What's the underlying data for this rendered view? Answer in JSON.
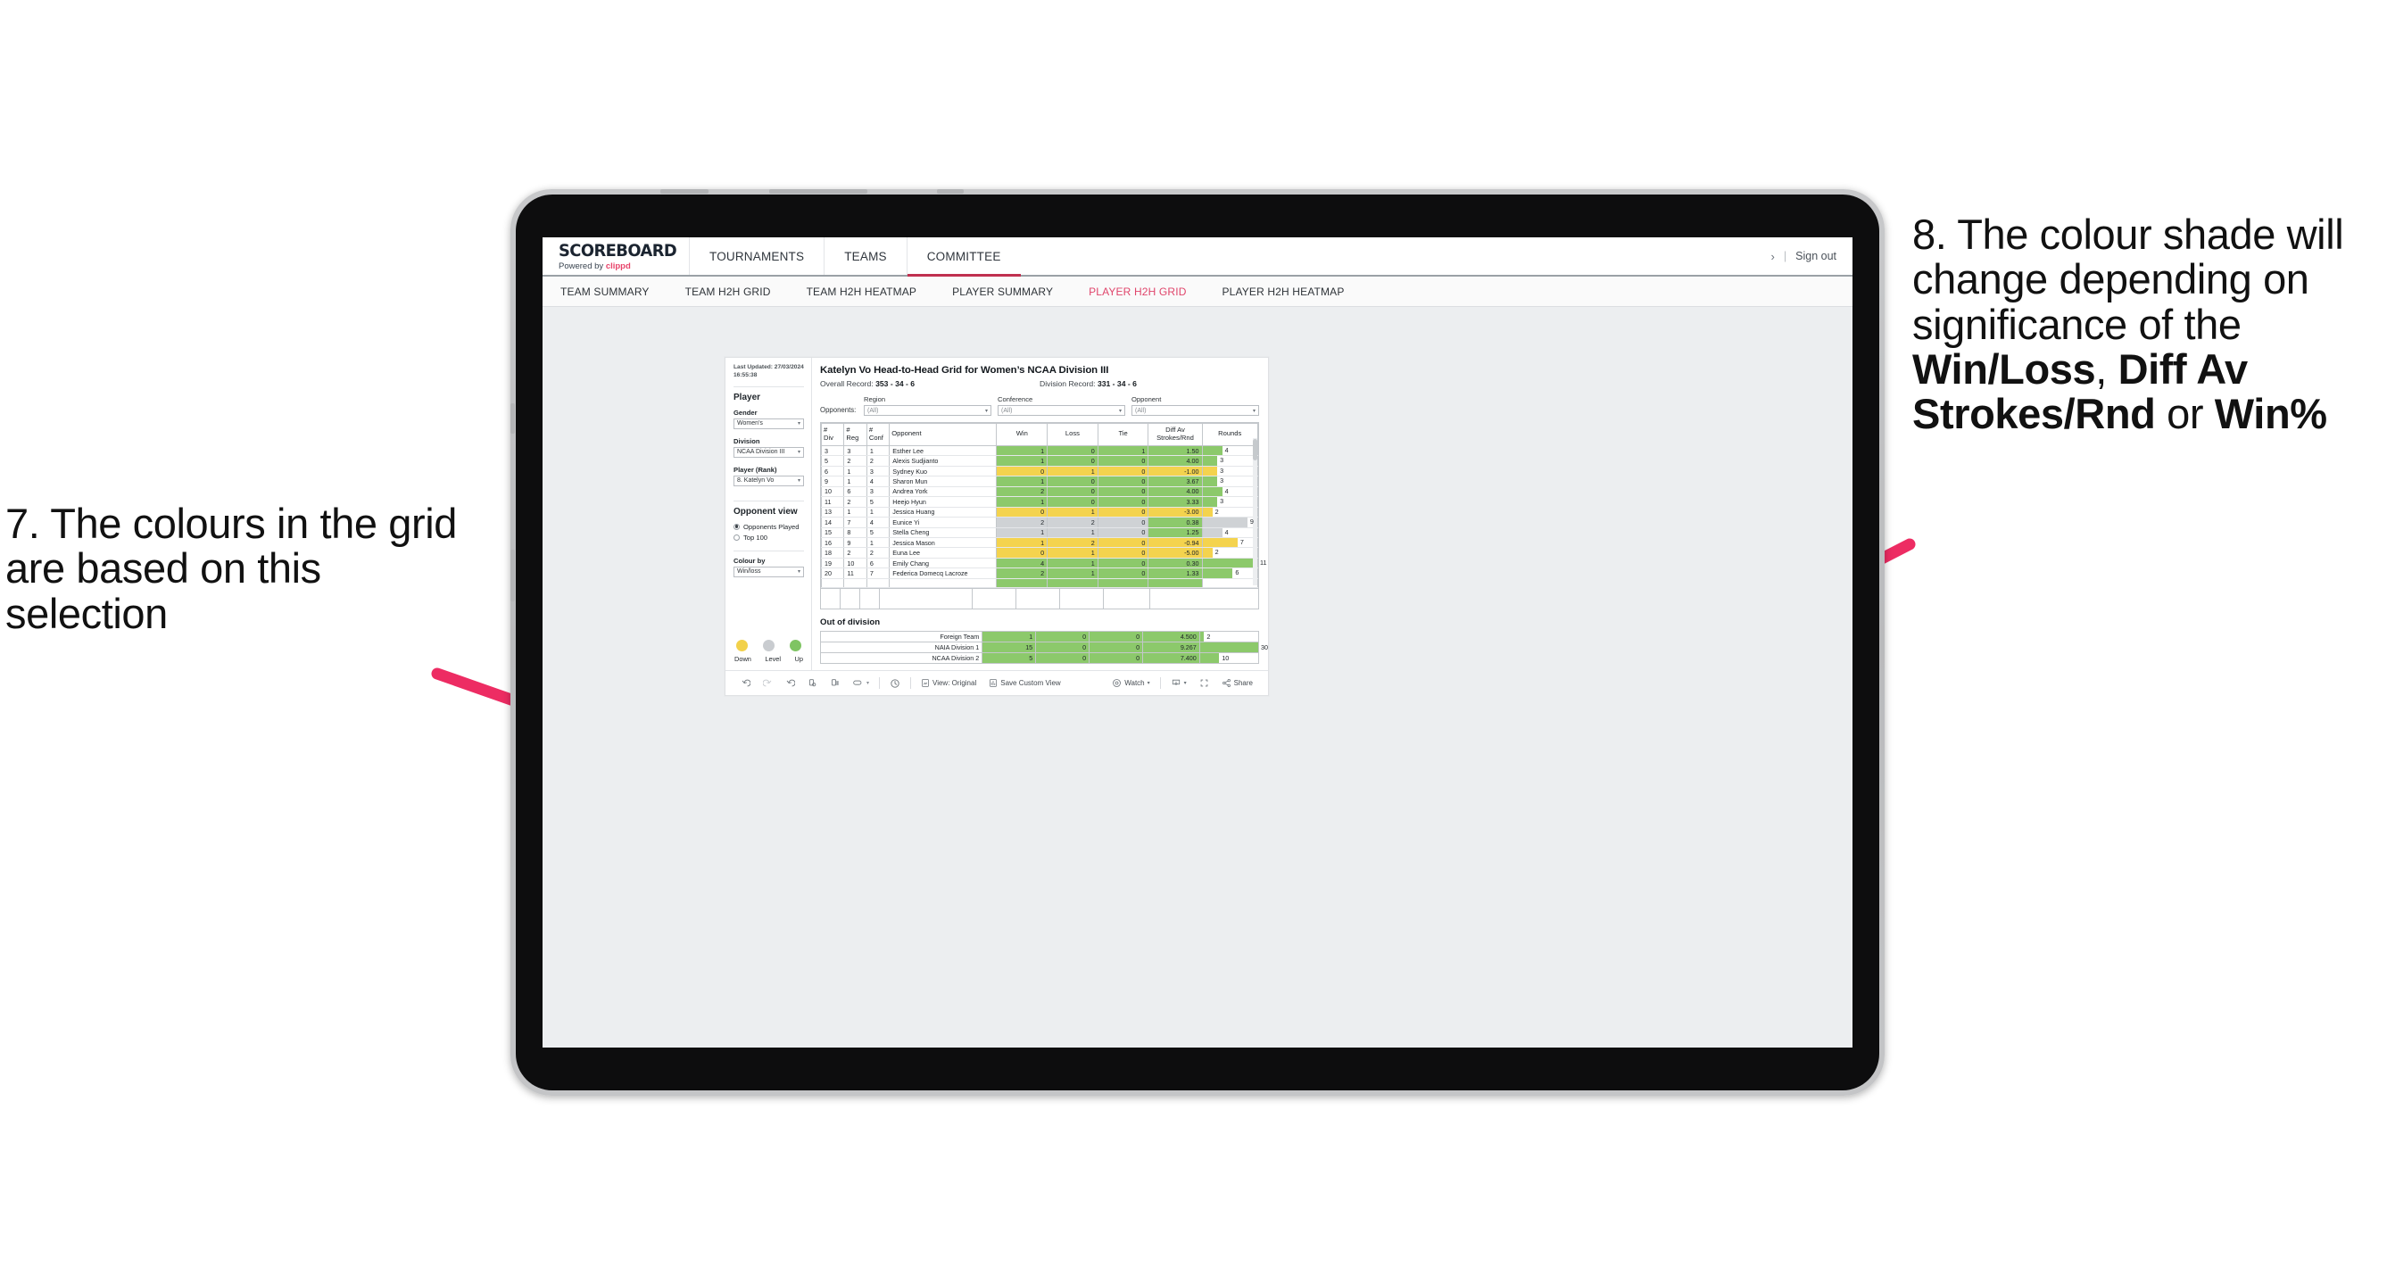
{
  "annotations": {
    "left": "7. The colours in the grid are based on this selection",
    "right_pre": "8. The colour shade will change depending on significance of the ",
    "right_b1": "Win/Loss",
    "right_mid1": ", ",
    "right_b2": "Diff Av Strokes/Rnd",
    "right_mid2": " or ",
    "right_b3": "Win%",
    "arrow_color": "#ED2C63"
  },
  "appbar": {
    "brand_title": "SCOREBOARD",
    "brand_sub_prefix": "Powered by ",
    "brand_sub_accent": "clippd",
    "nav": [
      {
        "label": "TOURNAMENTS",
        "active": false
      },
      {
        "label": "TEAMS",
        "active": false
      },
      {
        "label": "COMMITTEE",
        "active": true
      }
    ],
    "chevron": "›",
    "separator": "|",
    "sign_out": "Sign out",
    "active_color": "#C0304F"
  },
  "subnav": {
    "items": [
      {
        "label": "TEAM SUMMARY",
        "active": false
      },
      {
        "label": "TEAM H2H GRID",
        "active": false
      },
      {
        "label": "TEAM H2H HEATMAP",
        "active": false
      },
      {
        "label": "PLAYER SUMMARY",
        "active": false
      },
      {
        "label": "PLAYER H2H GRID",
        "active": true
      },
      {
        "label": "PLAYER H2H HEATMAP",
        "active": false
      }
    ],
    "active_color": "#E0456B"
  },
  "filters": {
    "last_updated": "Last Updated: 27/03/2024 16:55:38",
    "player_heading": "Player",
    "gender_label": "Gender",
    "gender_value": "Women’s",
    "division_label": "Division",
    "division_value": "NCAA Division III",
    "player_rank_label": "Player (Rank)",
    "player_rank_value": "8. Katelyn Vo",
    "opponent_view_heading": "Opponent view",
    "opponent_view_options": [
      {
        "label": "Opponents Played",
        "selected": true
      },
      {
        "label": "Top 100",
        "selected": false
      }
    ],
    "colour_by_label": "Colour by",
    "colour_by_value": "Win/loss",
    "legend": [
      {
        "label": "Down",
        "color": "#F2D14A"
      },
      {
        "label": "Level",
        "color": "#C9CCD0"
      },
      {
        "label": "Up",
        "color": "#7FC463"
      }
    ],
    "caret": "▾"
  },
  "grid": {
    "title": "Katelyn Vo Head-to-Head Grid for Women’s NCAA Division III",
    "overall_record_label": "Overall Record: ",
    "overall_record_value": "353 - 34 - 6",
    "division_record_label": "Division Record: ",
    "division_record_value": "331 - 34 - 6",
    "opponents_label": "Opponents:",
    "opponent_filters": [
      {
        "label": "Region",
        "value": "(All)"
      },
      {
        "label": "Conference",
        "value": "(All)"
      },
      {
        "label": "Opponent",
        "value": "(All)"
      }
    ],
    "out_of_division_title": "Out of division"
  },
  "chart_data": {
    "type": "table",
    "title": "Katelyn Vo Head-to-Head Grid for Women’s NCAA Division III",
    "columns": [
      "# Div",
      "# Reg",
      "# Conf",
      "Opponent",
      "Win",
      "Loss",
      "Tie",
      "Diff Av Strokes/Rnd",
      "Rounds"
    ],
    "column_headers_two_line": [
      {
        "l1": "#",
        "l2": "Div"
      },
      {
        "l1": "#",
        "l2": "Reg"
      },
      {
        "l1": "#",
        "l2": "Conf"
      },
      {
        "l1": "Opponent",
        "l2": ""
      },
      {
        "l1": "Win",
        "l2": ""
      },
      {
        "l1": "Loss",
        "l2": ""
      },
      {
        "l1": "Tie",
        "l2": ""
      },
      {
        "l1": "Diff Av",
        "l2": "Strokes/Rnd"
      },
      {
        "l1": "Rounds",
        "l2": ""
      }
    ],
    "rows": [
      {
        "div": "3",
        "reg": "3",
        "conf": "1",
        "opponent": "Esther Lee",
        "win": "1",
        "loss": "0",
        "tie": "1",
        "diff": "1.50",
        "rounds": "4",
        "color": "green",
        "diff_color": "green",
        "rounds_pct": 36
      },
      {
        "div": "5",
        "reg": "2",
        "conf": "2",
        "opponent": "Alexis Sudjianto",
        "win": "1",
        "loss": "0",
        "tie": "0",
        "diff": "4.00",
        "rounds": "3",
        "color": "green",
        "diff_color": "green",
        "rounds_pct": 27
      },
      {
        "div": "6",
        "reg": "1",
        "conf": "3",
        "opponent": "Sydney Kuo",
        "win": "0",
        "loss": "1",
        "tie": "0",
        "diff": "-1.00",
        "rounds": "3",
        "color": "yellow",
        "diff_color": "yellow",
        "rounds_pct": 27
      },
      {
        "div": "9",
        "reg": "1",
        "conf": "4",
        "opponent": "Sharon Mun",
        "win": "1",
        "loss": "0",
        "tie": "0",
        "diff": "3.67",
        "rounds": "3",
        "color": "green",
        "diff_color": "green",
        "rounds_pct": 27
      },
      {
        "div": "10",
        "reg": "6",
        "conf": "3",
        "opponent": "Andrea York",
        "win": "2",
        "loss": "0",
        "tie": "0",
        "diff": "4.00",
        "rounds": "4",
        "color": "green",
        "diff_color": "green",
        "rounds_pct": 36
      },
      {
        "div": "11",
        "reg": "2",
        "conf": "5",
        "opponent": "Heejo Hyun",
        "win": "1",
        "loss": "0",
        "tie": "0",
        "diff": "3.33",
        "rounds": "3",
        "color": "green",
        "diff_color": "green",
        "rounds_pct": 27
      },
      {
        "div": "13",
        "reg": "1",
        "conf": "1",
        "opponent": "Jessica Huang",
        "win": "0",
        "loss": "1",
        "tie": "0",
        "diff": "-3.00",
        "rounds": "2",
        "color": "yellow",
        "diff_color": "yellow",
        "rounds_pct": 18
      },
      {
        "div": "14",
        "reg": "7",
        "conf": "4",
        "opponent": "Eunice Yi",
        "win": "2",
        "loss": "2",
        "tie": "0",
        "diff": "0.38",
        "rounds": "9",
        "color": "grey",
        "diff_color": "green",
        "rounds_pct": 82
      },
      {
        "div": "15",
        "reg": "8",
        "conf": "5",
        "opponent": "Stella Cheng",
        "win": "1",
        "loss": "1",
        "tie": "0",
        "diff": "1.25",
        "rounds": "4",
        "color": "grey",
        "diff_color": "green",
        "rounds_pct": 36
      },
      {
        "div": "16",
        "reg": "9",
        "conf": "1",
        "opponent": "Jessica Mason",
        "win": "1",
        "loss": "2",
        "tie": "0",
        "diff": "-0.94",
        "rounds": "7",
        "color": "yellow",
        "diff_color": "yellow",
        "rounds_pct": 64
      },
      {
        "div": "18",
        "reg": "2",
        "conf": "2",
        "opponent": "Euna Lee",
        "win": "0",
        "loss": "1",
        "tie": "0",
        "diff": "-5.00",
        "rounds": "2",
        "color": "yellow",
        "diff_color": "yellow",
        "rounds_pct": 18
      },
      {
        "div": "19",
        "reg": "10",
        "conf": "6",
        "opponent": "Emily Chang",
        "win": "4",
        "loss": "1",
        "tie": "0",
        "diff": "0.30",
        "rounds": "11",
        "color": "green",
        "diff_color": "green",
        "rounds_pct": 100
      },
      {
        "div": "20",
        "reg": "11",
        "conf": "7",
        "opponent": "Federica Domecq Lacroze",
        "win": "2",
        "loss": "1",
        "tie": "0",
        "diff": "1.33",
        "rounds": "6",
        "color": "green",
        "diff_color": "green",
        "rounds_pct": 55
      }
    ],
    "out_of_division_rows": [
      {
        "name": "Foreign Team",
        "win": "1",
        "loss": "0",
        "tie": "0",
        "diff": "4.500",
        "rounds": "2",
        "color": "green",
        "rounds_pct": 7
      },
      {
        "name": "NAIA Division 1",
        "win": "15",
        "loss": "0",
        "tie": "0",
        "diff": "9.267",
        "rounds": "30",
        "color": "green",
        "rounds_pct": 100
      },
      {
        "name": "NCAA Division 2",
        "win": "5",
        "loss": "0",
        "tie": "0",
        "diff": "7.400",
        "rounds": "10",
        "color": "green",
        "rounds_pct": 33
      }
    ],
    "colors": {
      "green": "#8CC96B",
      "yellow": "#F4D34E",
      "grey": "#CFD2D5",
      "white": "#FFFFFF"
    }
  },
  "toolbar": {
    "view_label": "View: Original",
    "save_label": "Save Custom View",
    "watch_label": "Watch",
    "share_label": "Share",
    "caret": "▾"
  }
}
